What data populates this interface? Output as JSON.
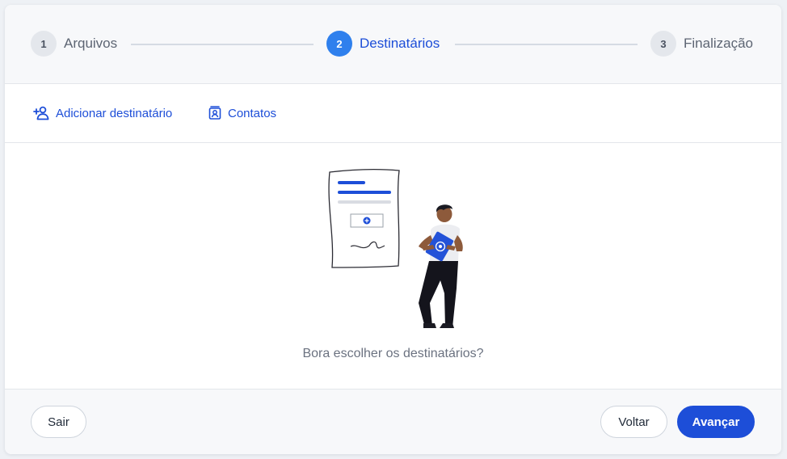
{
  "stepper": {
    "steps": [
      {
        "number": "1",
        "label": "Arquivos",
        "state": "inactive"
      },
      {
        "number": "2",
        "label": "Destinatários",
        "state": "active"
      },
      {
        "number": "3",
        "label": "Finalização",
        "state": "inactive"
      }
    ]
  },
  "actions": {
    "add_recipient": {
      "label": "Adicionar destinatário",
      "icon": "person-add-icon"
    },
    "contacts": {
      "label": "Contatos",
      "icon": "contacts-icon"
    }
  },
  "empty_state": {
    "message": "Bora escolher os destinatários?",
    "illustration": "person-holding-document-illustration"
  },
  "footer": {
    "exit_label": "Sair",
    "back_label": "Voltar",
    "next_label": "Avançar"
  },
  "colors": {
    "primary": "#1d4ed8",
    "active_step": "#2f80ed",
    "inactive_step_bg": "#e4e7ec",
    "muted_text": "#6b7280"
  }
}
